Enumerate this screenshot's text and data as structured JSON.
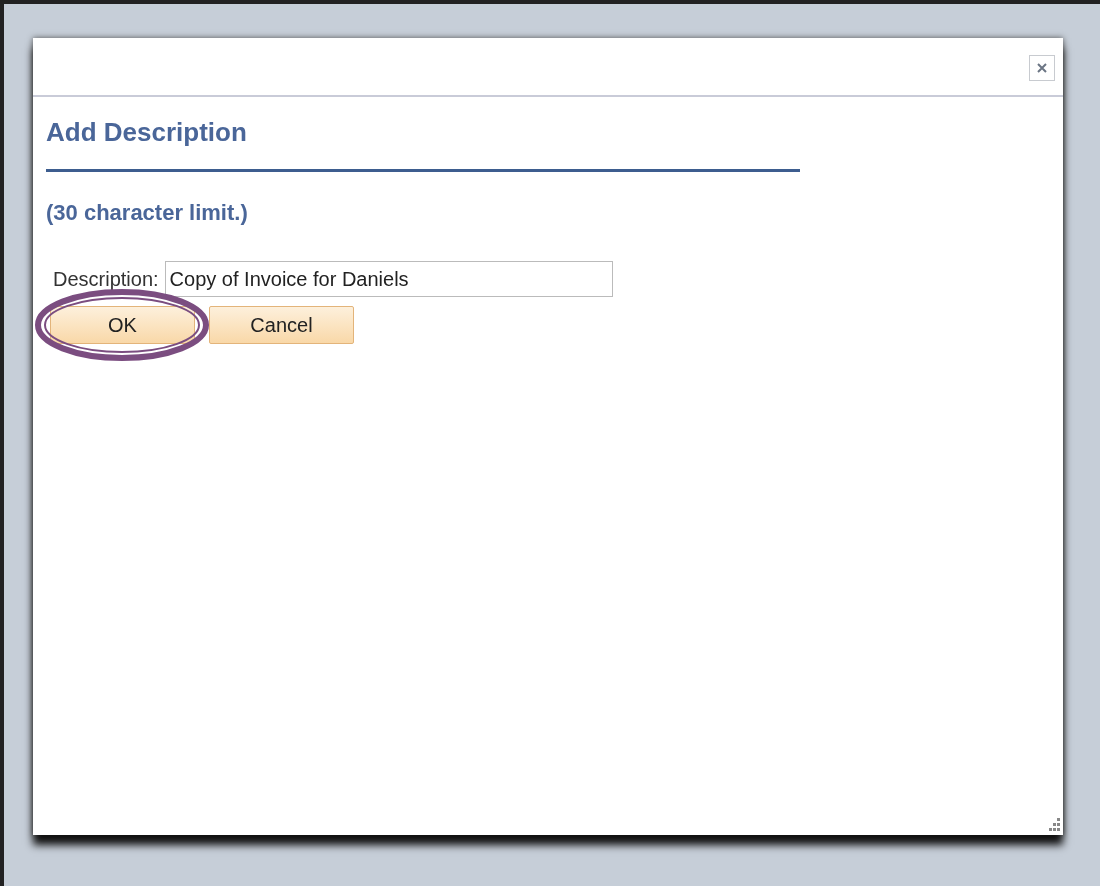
{
  "dialog": {
    "title": "Add Description",
    "subtitle": "(30 character limit.)",
    "field": {
      "label": "Description:",
      "value": "Copy of Invoice for Daniels"
    },
    "buttons": [
      {
        "label": "OK",
        "highlighted": true
      },
      {
        "label": "Cancel",
        "highlighted": false
      }
    ]
  }
}
